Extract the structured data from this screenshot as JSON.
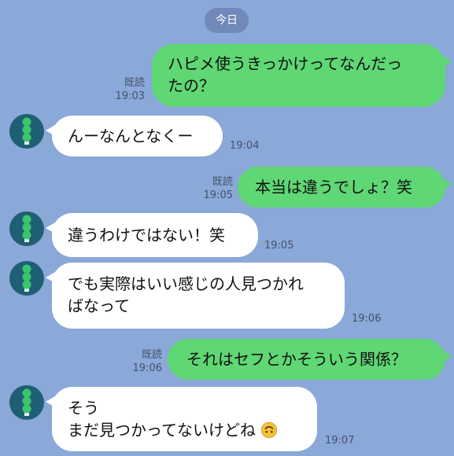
{
  "date_label": "今日",
  "read_label": "既読",
  "messages": [
    {
      "side": "out",
      "lines": [
        "ハピメ使うきっかけってなんだっ",
        "たの？"
      ],
      "time": "19:03",
      "read": true
    },
    {
      "side": "in",
      "lines": [
        "んーなんとなくー"
      ],
      "time": "19:04"
    },
    {
      "side": "out",
      "lines": [
        "本当は違うでしょ？笑"
      ],
      "time": "19:05",
      "read": true
    },
    {
      "side": "in",
      "lines": [
        "違うわけではない！笑"
      ],
      "time": "19:05"
    },
    {
      "side": "in",
      "lines": [
        "でも実際はいい感じの人見つかれ",
        "ばなって"
      ],
      "time": "19:06"
    },
    {
      "side": "out",
      "lines": [
        "それはセフとかそういう関係？"
      ],
      "time": "19:06",
      "read": true
    },
    {
      "side": "in",
      "lines": [
        "そう",
        "まだ見つかってないけどね"
      ],
      "time": "19:07",
      "emoji": "upside-down-face-emoji"
    }
  ],
  "icons": {
    "avatar": "traffic-light-icon",
    "emoji": "upside-down-face-emoji"
  },
  "colors": {
    "background": "#8aa8d8",
    "outgoing_bubble": "#5fd774",
    "incoming_bubble": "#ffffff",
    "avatar_bg": "#1f5f73",
    "avatar_icon": "#38c66c"
  }
}
